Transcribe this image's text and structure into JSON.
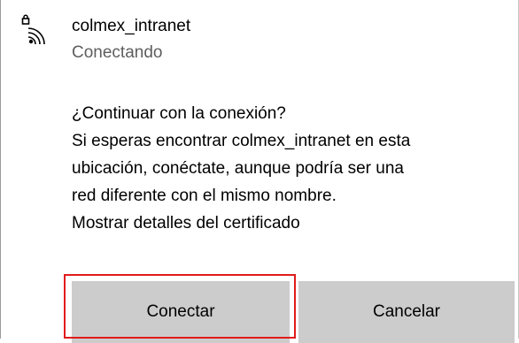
{
  "network": {
    "icon": "wifi-secured-icon",
    "name": "colmex_intranet",
    "status": "Conectando"
  },
  "message": {
    "lines": [
      "¿Continuar con la conexión?",
      "Si esperas encontrar colmex_intranet en esta",
      "ubicación, conéctate, aunque podría ser una",
      "red diferente con el mismo nombre.",
      "Mostrar detalles del certificado"
    ]
  },
  "buttons": {
    "connect_label": "Conectar",
    "cancel_label": "Cancelar"
  },
  "colors": {
    "button_bg": "#cccccc",
    "highlight": "#e21b1b",
    "status_text": "#5e5e5e"
  }
}
